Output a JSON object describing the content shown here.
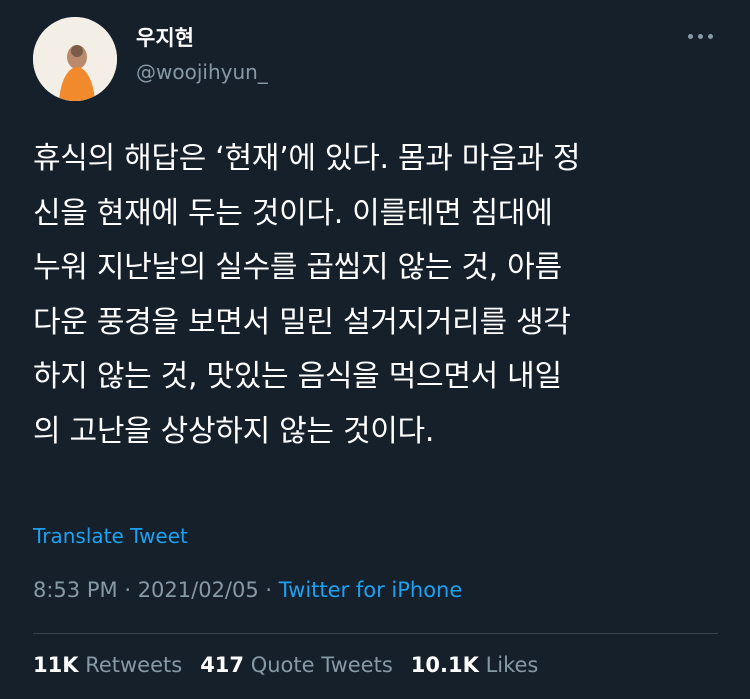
{
  "author": {
    "display_name": "우지현",
    "handle": "@woojihyun_"
  },
  "tweet": {
    "lines": [
      "휴식의 해답은 ‘현재’에 있다. 몸과 마음과 정",
      "신을 현재에 두는 것이다. 이를테면 침대에",
      "누워 지난날의 실수를 곱씹지 않는 것, 아름",
      "다운 풍경을 보면서 밀린 설거지거리를 생각",
      "하지 않는 것, 맛있는 음식을 먹으면서 내일",
      "의 고난을 상상하지 않는 것이다."
    ],
    "translate_label": "Translate Tweet"
  },
  "meta": {
    "time": "8:53 PM",
    "separator": "·",
    "date": "2021/02/05",
    "source": "Twitter for iPhone"
  },
  "stats": {
    "retweets_count": "11K",
    "retweets_label": "Retweets",
    "quotes_count": "417",
    "quotes_label": "Quote Tweets",
    "likes_count": "10.1K",
    "likes_label": "Likes"
  },
  "icons": {
    "more": "more-horizontal-icon"
  },
  "colors": {
    "background": "#15202b",
    "link": "#1da1f2",
    "secondary_text": "#8899a6",
    "divider": "#38444d"
  }
}
